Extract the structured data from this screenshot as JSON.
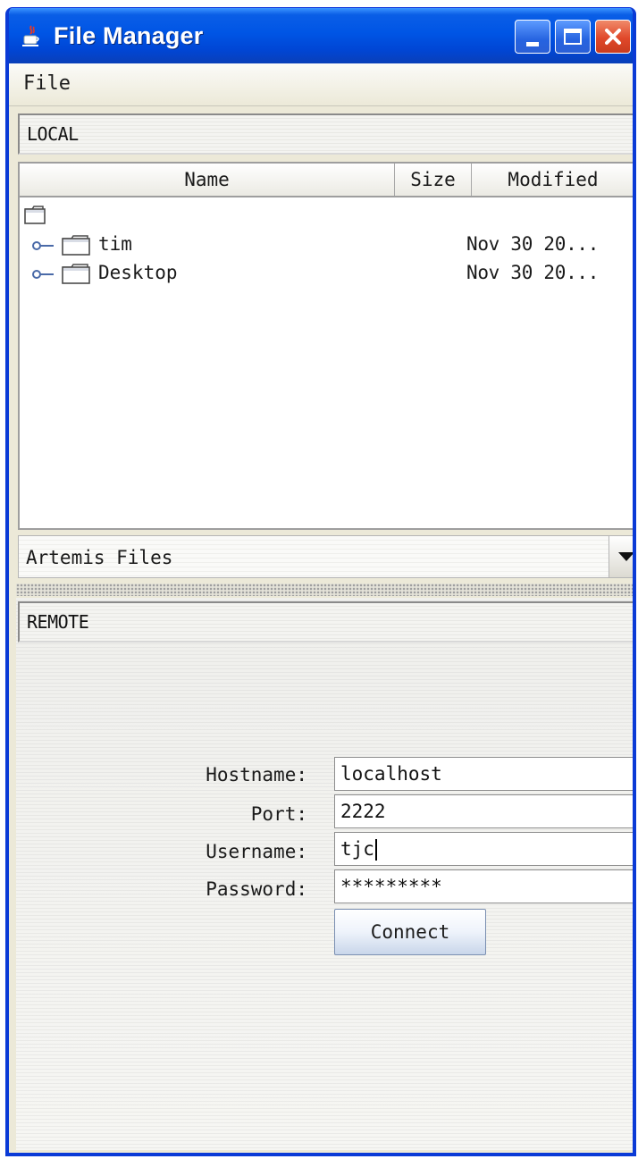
{
  "window": {
    "title": "File Manager"
  },
  "menu": {
    "file_label": "File"
  },
  "local": {
    "path_label": "LOCAL",
    "columns": {
      "name": "Name",
      "size": "Size",
      "modified": "Modified"
    },
    "rows": [
      {
        "name": "tim",
        "size": "",
        "modified": "Nov 30 20..."
      },
      {
        "name": "Desktop",
        "size": "",
        "modified": "Nov 30 20..."
      }
    ]
  },
  "filter": {
    "selected": "Artemis Files"
  },
  "remote": {
    "path_label": "REMOTE",
    "form": {
      "hostname_label": "Hostname:",
      "hostname_value": "localhost",
      "port_label": "Port:",
      "port_value": "2222",
      "username_label": "Username:",
      "username_value": "tjc",
      "password_label": "Password:",
      "password_value": "*********",
      "connect_label": "Connect"
    }
  },
  "icons": {
    "app": "java-cup-icon",
    "minimize": "minimize-icon",
    "maximize": "maximize-icon",
    "close": "close-icon",
    "folder": "folder-icon",
    "dropdown": "chevron-down-icon"
  },
  "colors": {
    "titlebar": "#0055e5",
    "close": "#e0482a",
    "window_bg": "#ece9d8"
  }
}
